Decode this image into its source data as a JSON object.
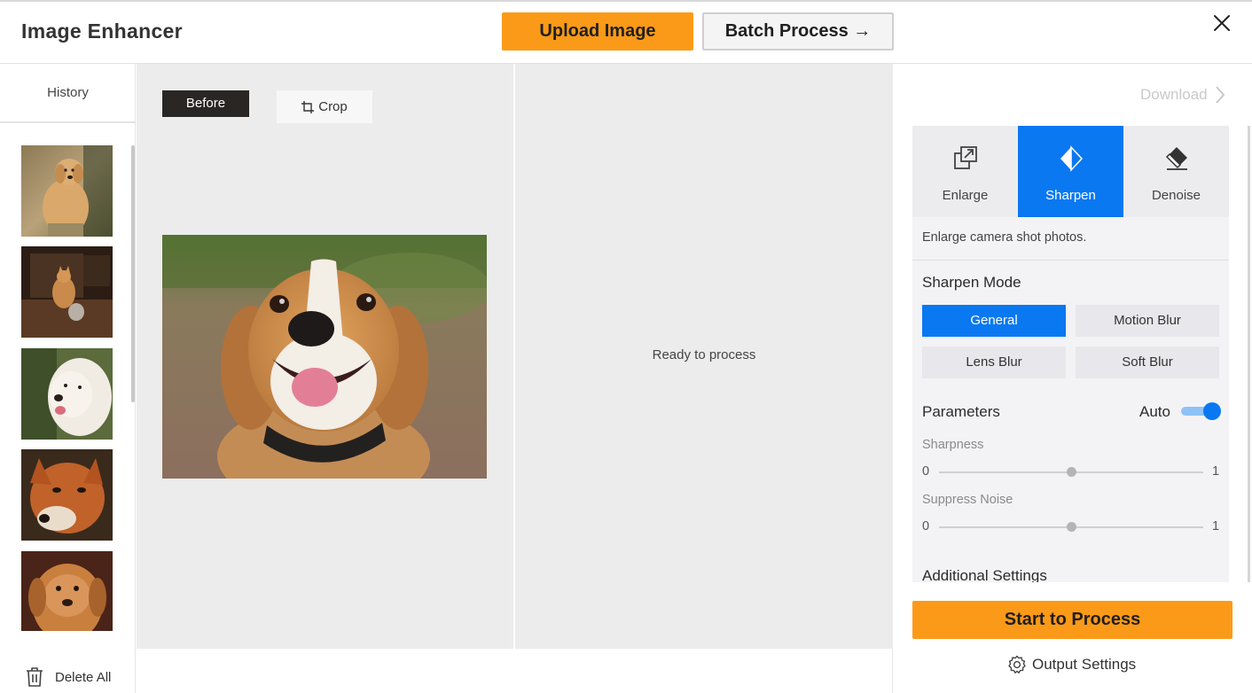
{
  "header": {
    "title": "Image Enhancer",
    "upload_label": "Upload Image",
    "batch_label": "Batch Process →",
    "close_icon": "close-icon"
  },
  "sidebar": {
    "history_label": "History",
    "thumbnails": [
      {
        "subject": "golden retriever standing",
        "icon": "thumbnail-image"
      },
      {
        "subject": "cat in dark room",
        "icon": "thumbnail-image"
      },
      {
        "subject": "white retriever",
        "icon": "thumbnail-image"
      },
      {
        "subject": "red fox",
        "icon": "thumbnail-image"
      },
      {
        "subject": "golden dog close-up",
        "icon": "thumbnail-image"
      }
    ],
    "delete_all_label": "Delete All",
    "delete_icon": "trash-icon"
  },
  "canvas": {
    "before_label": "Before",
    "crop_label": "Crop",
    "crop_icon": "crop-icon",
    "status_text": "Ready to process"
  },
  "right_panel": {
    "download_label": "Download",
    "download_icon": "chevron-right-icon",
    "tabs": [
      {
        "label": "Enlarge",
        "icon": "enlarge-icon",
        "active": false
      },
      {
        "label": "Sharpen",
        "icon": "sharpen-icon",
        "active": true
      },
      {
        "label": "Denoise",
        "icon": "eraser-icon",
        "active": false
      }
    ],
    "description": "Enlarge camera shot photos.",
    "sharpen_mode_title": "Sharpen Mode",
    "modes": [
      {
        "label": "General",
        "active": true
      },
      {
        "label": "Motion Blur",
        "active": false
      },
      {
        "label": "Lens Blur",
        "active": false
      },
      {
        "label": "Soft Blur",
        "active": false
      }
    ],
    "parameters_title": "Parameters",
    "auto_label": "Auto",
    "auto_enabled": true,
    "sliders": [
      {
        "label": "Sharpness",
        "min": "0",
        "max": "1",
        "value": 0.5
      },
      {
        "label": "Suppress Noise",
        "min": "0",
        "max": "1",
        "value": 0.5
      }
    ],
    "additional_settings_title": "Additional Settings",
    "start_label": "Start to Process",
    "output_settings_label": "Output Settings",
    "output_settings_icon": "gear-icon"
  },
  "colors": {
    "accent_orange": "#fb9a18",
    "accent_blue": "#0a78f0",
    "canvas_bg": "#ececec",
    "before_badge": "#2a2624"
  }
}
